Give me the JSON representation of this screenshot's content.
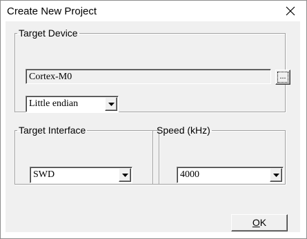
{
  "window": {
    "title": "Create New Project",
    "close_icon": "close-icon"
  },
  "target_device": {
    "legend": "Target Device",
    "device_value": "Cortex-M0",
    "browse_label": "...",
    "endian_value": "Little endian"
  },
  "target_interface": {
    "legend": "Target Interface",
    "value": "SWD"
  },
  "speed": {
    "legend": "Speed (kHz)",
    "value": "4000"
  },
  "buttons": {
    "ok_mnemonic": "O",
    "ok_rest": "K"
  },
  "colors": {
    "dialog_bg": "#f0f0f0",
    "title_bg": "#ffffff"
  }
}
